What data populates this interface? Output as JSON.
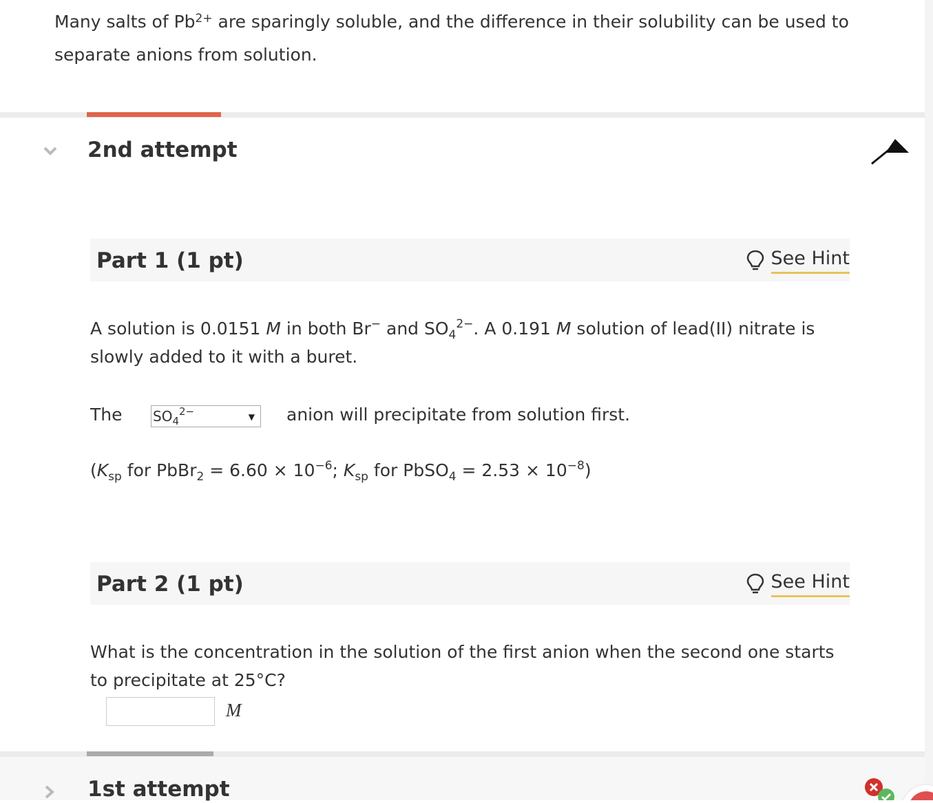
{
  "intro": {
    "text_before": "Many salts of Pb",
    "superscript": "2+",
    "text_after": " are sparingly soluble, and the difference in their solubility can be used to separate anions from solution."
  },
  "attempt_current": {
    "title": "2nd attempt",
    "progress_color": "#e0644a"
  },
  "part1": {
    "title": "Part 1 (1 pt)",
    "hint_label": "See Hint",
    "q_a": "A solution is 0.0151 ",
    "q_M1": "M",
    "q_b": " in both Br",
    "q_br_sup": "−",
    "q_c": " and SO",
    "q_so4_sub": "4",
    "q_so4_sup": "2−",
    "q_d": ". A 0.191 ",
    "q_M2": "M",
    "q_e": " solution of lead(II) nitrate is slowly added to it with a buret.",
    "sentence_start": "The",
    "dropdown": {
      "base": "SO",
      "sub": "4",
      "sup": "2−",
      "arrow": "▼"
    },
    "sentence_end": "anion will precipitate from solution first.",
    "ksp_open": "(",
    "ksp_K1": "K",
    "ksp_sp1": "sp",
    "ksp_mid1": " for PbBr",
    "ksp_sub1": "2",
    "ksp_val1": " = 6.60 × 10",
    "ksp_exp1": "−6",
    "ksp_sep": "; ",
    "ksp_K2": "K",
    "ksp_sp2": "sp",
    "ksp_mid2": " for PbSO",
    "ksp_sub2": "4",
    "ksp_val2": " = 2.53 × 10",
    "ksp_exp2": "−8",
    "ksp_close": ")"
  },
  "part2": {
    "title": "Part 2 (1 pt)",
    "hint_label": "See Hint",
    "question": "What is the concentration in the solution of the first anion when the second one starts to precipitate at 25°C?",
    "input_value": "",
    "unit": "M"
  },
  "attempt_previous": {
    "title": "1st attempt",
    "progress_color": "#aaaaaa"
  },
  "colors": {
    "hint_underline": "#e8c35a",
    "status_wrong": "#d0312d",
    "status_correct": "#5cb85c"
  },
  "icons": {
    "chevron_open": "chevron-down-icon",
    "chevron_closed": "chevron-right-icon",
    "hint": "lightbulb-icon",
    "collapse": "arrow-up-icon",
    "status": "status-icon"
  }
}
